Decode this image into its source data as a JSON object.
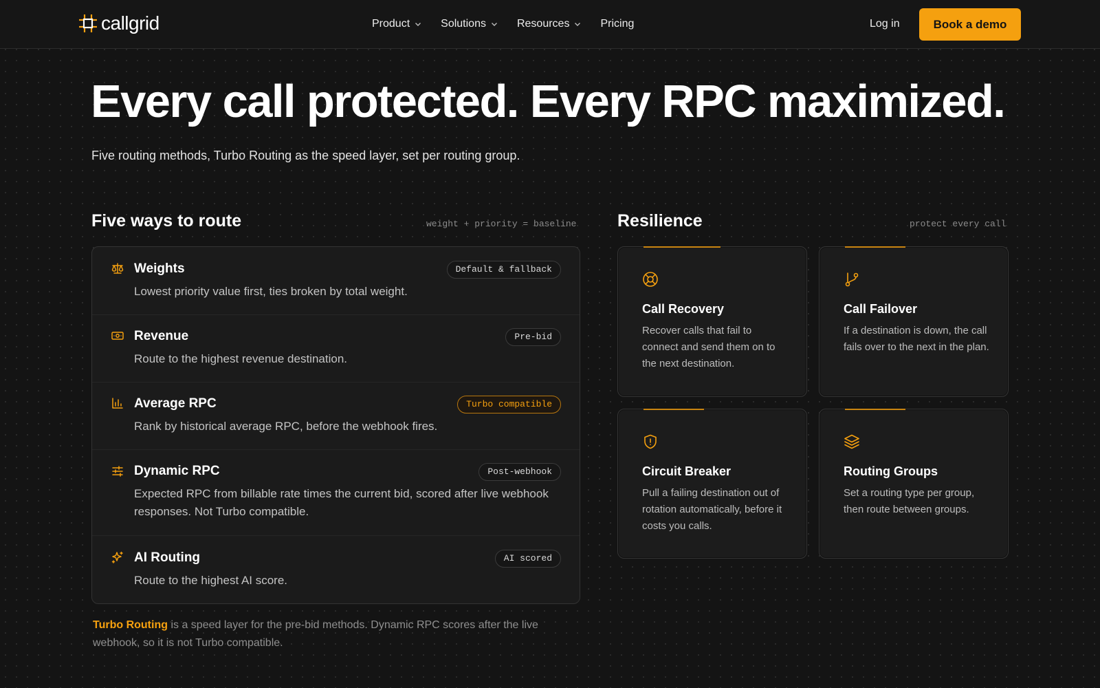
{
  "brand": {
    "name": "callgrid",
    "accent": "#f5a00f"
  },
  "nav": {
    "items": [
      {
        "label": "Product",
        "has_dropdown": true
      },
      {
        "label": "Solutions",
        "has_dropdown": true
      },
      {
        "label": "Resources",
        "has_dropdown": true
      },
      {
        "label": "Pricing",
        "has_dropdown": false
      }
    ],
    "login": "Log in",
    "cta": "Book a demo"
  },
  "hero": {
    "title": "Every call protected. Every RPC maximized.",
    "subtitle": "Five routing methods, Turbo Routing as the speed layer, set per routing group."
  },
  "routing": {
    "title": "Five ways to route",
    "tag": "weight + priority = baseline",
    "methods": [
      {
        "name": "Weights",
        "icon": "scale-icon",
        "description": "Lowest priority value first, ties broken by total weight.",
        "badge": "Default & fallback",
        "badge_accent": false
      },
      {
        "name": "Revenue",
        "icon": "banknote-icon",
        "description": "Route to the highest revenue destination.",
        "badge": "Pre-bid",
        "badge_accent": false
      },
      {
        "name": "Average RPC",
        "icon": "bar-chart-icon",
        "description": "Rank by historical average RPC, before the webhook fires.",
        "badge": "Turbo compatible",
        "badge_accent": true
      },
      {
        "name": "Dynamic RPC",
        "icon": "sliders-icon",
        "description": "Expected RPC from billable rate times the current bid, scored after live webhook responses. Not Turbo compatible.",
        "badge": "Post-webhook",
        "badge_accent": false
      },
      {
        "name": "AI Routing",
        "icon": "sparkles-icon",
        "description": "Route to the highest AI score.",
        "badge": "AI scored",
        "badge_accent": false
      }
    ],
    "footnote": {
      "highlight": "Turbo Routing",
      "text": " is a speed layer for the pre-bid methods. Dynamic RPC scores after the live webhook, so it is not Turbo compatible."
    }
  },
  "resilience": {
    "title": "Resilience",
    "tag": "protect every call",
    "cards": [
      {
        "title": "Call Recovery",
        "icon": "lifebuoy-icon",
        "description": "Recover calls that fail to connect and send them on to the next destination."
      },
      {
        "title": "Call Failover",
        "icon": "git-branch-icon",
        "description": "If a destination is down, the call fails over to the next in the plan."
      },
      {
        "title": "Circuit Breaker",
        "icon": "shield-alert-icon",
        "description": "Pull a failing destination out of rotation automatically, before it costs you calls."
      },
      {
        "title": "Routing Groups",
        "icon": "layers-icon",
        "description": "Set a routing type per group, then route between groups."
      }
    ]
  }
}
